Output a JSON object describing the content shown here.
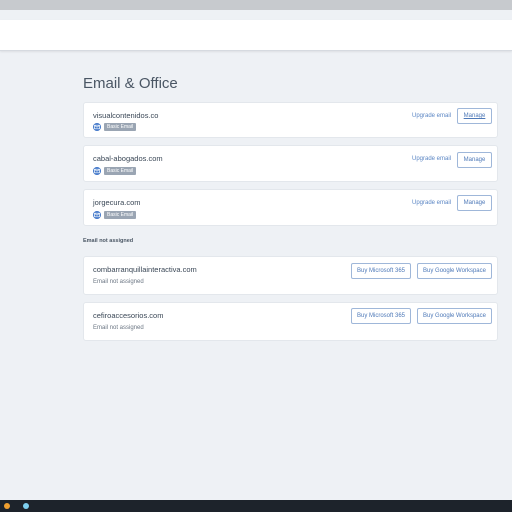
{
  "page": {
    "title": "Email & Office",
    "section_unassigned_label": "Email not assigned"
  },
  "assigned_domains": [
    {
      "domain": "visualcontenidos.co",
      "badge": "Basic Email",
      "upgrade_label": "Upgrade email",
      "manage_label": "Manage"
    },
    {
      "domain": "cabal-abogados.com",
      "badge": "Basic Email",
      "upgrade_label": "Upgrade email",
      "manage_label": "Manage"
    },
    {
      "domain": "jorgecura.com",
      "badge": "Basic Email",
      "upgrade_label": "Upgrade email",
      "manage_label": "Manage"
    }
  ],
  "unassigned_domains": [
    {
      "domain": "combarranquillainteractiva.com",
      "status": "Email not assigned",
      "buy_ms_label": "Buy Microsoft 365",
      "buy_google_label": "Buy Google Workspace"
    },
    {
      "domain": "cefiroaccesorios.com",
      "status": "Email not assigned",
      "buy_ms_label": "Buy Microsoft 365",
      "buy_google_label": "Buy Google Workspace"
    }
  ],
  "colors": {
    "accent": "#4e79b8",
    "badge": "#9aa5b3",
    "page_bg": "#eef1f5"
  }
}
